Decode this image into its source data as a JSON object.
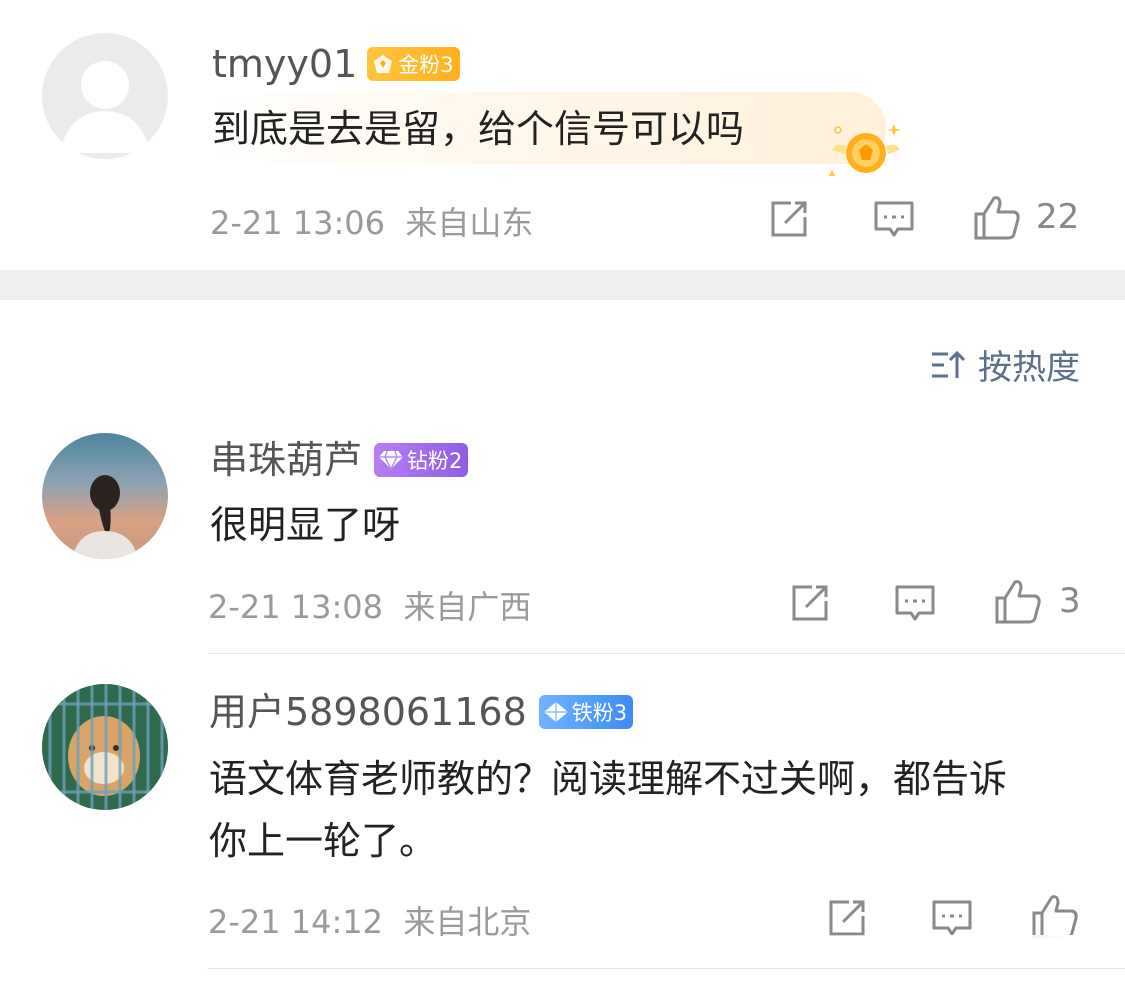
{
  "comments": [
    {
      "username": "tmyy01",
      "badge": {
        "label": "金粉3",
        "type": "gold"
      },
      "text": "到底是去是留，给个信号可以吗",
      "date": "2-21 13:06",
      "location": "来自山东",
      "likes": "22"
    },
    {
      "username": "串珠葫芦",
      "badge": {
        "label": "钻粉2",
        "type": "diamond"
      },
      "text": "很明显了呀",
      "date": "2-21 13:08",
      "location": "来自广西",
      "likes": "3"
    },
    {
      "username": "用户5898061168",
      "badge": {
        "label": "铁粉3",
        "type": "iron"
      },
      "text_line1": "语文体育老师教的？阅读理解不过关啊，都告诉",
      "text_line2": "你上一轮了。",
      "date": "2-21 14:12",
      "location": "来自北京",
      "likes": ""
    }
  ],
  "sort": {
    "label": "按热度",
    "icon": "sort-icon"
  },
  "colors": {
    "gold": "#ffb01f",
    "diamond": "#9b63ea",
    "iron": "#4a95f7",
    "section_gap": "#efefef"
  }
}
